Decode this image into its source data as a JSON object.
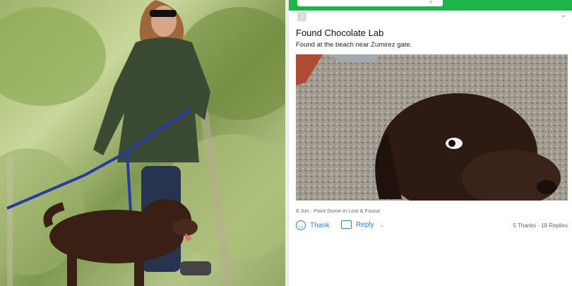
{
  "post": {
    "avatar_initial": "J",
    "title": "Found Chocolate Lab",
    "body": "Found at the beach near Zumirez gate.",
    "meta": "8 Jun · Point Dume in Lost & Found",
    "thank_label": "Thank",
    "reply_label": "Reply",
    "stats": "5 Thanks · 18 Replies"
  },
  "icons": {
    "search": "search-icon",
    "more": "chevron-down-icon",
    "thank": "smiley-icon",
    "reply": "speech-bubble-icon"
  },
  "colors": {
    "header": "#1fb34a",
    "link": "#2b7fbf"
  }
}
